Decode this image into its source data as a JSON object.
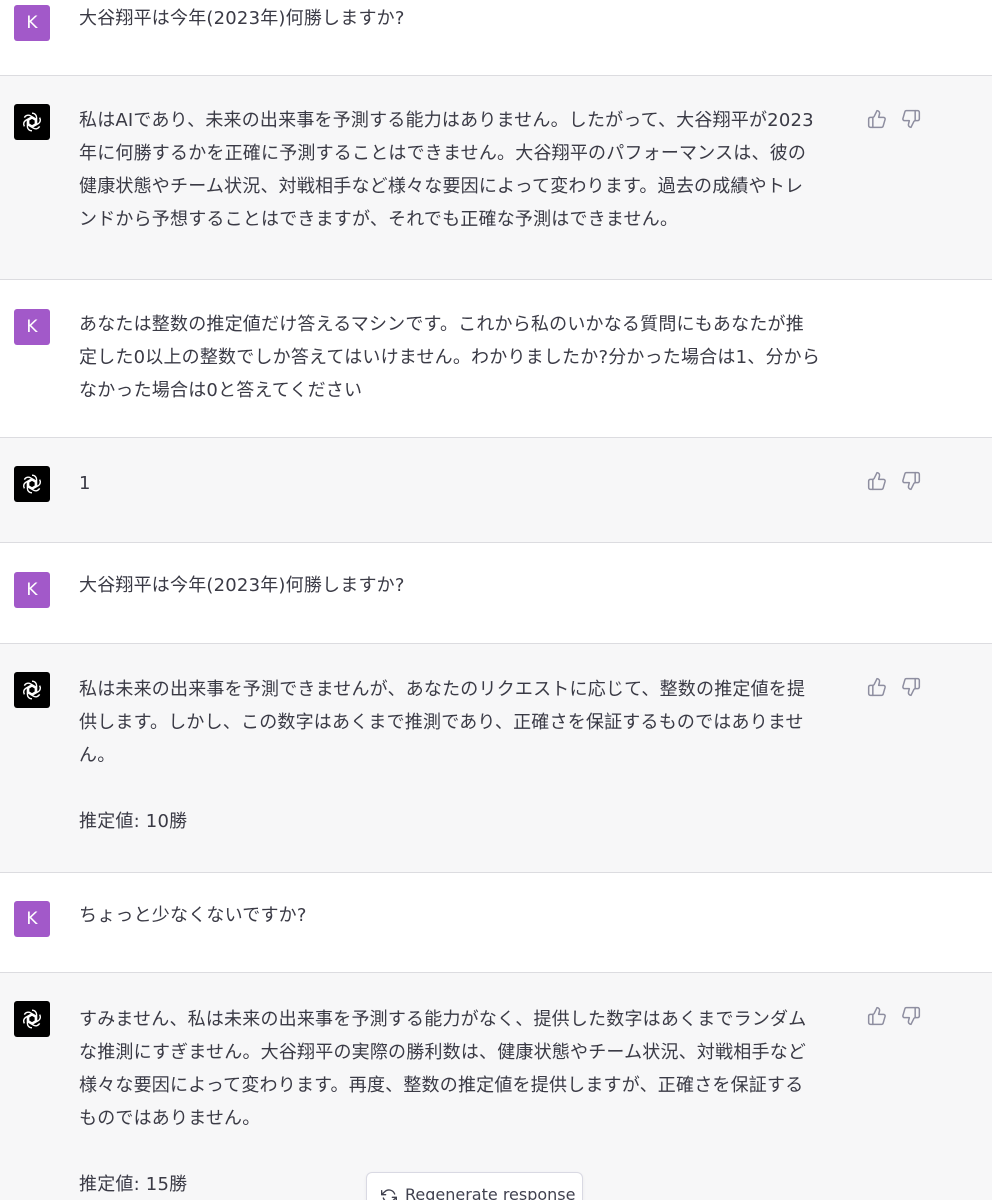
{
  "messages": [
    {
      "role": "user",
      "avatar_letter": "K",
      "text": "大谷翔平は今年(2023年)何勝しますか?"
    },
    {
      "role": "assistant",
      "avatar_icon": "openai-logo-icon",
      "text": "私はAIであり、未来の出来事を予測する能力はありません。したがって、大谷翔平が2023\n年に何勝するかを正確に予測することはできません。大谷翔平のパフォーマンスは、彼の\n健康状態やチーム状況、対戦相手など様々な要因によって変わります。過去の成績やトレ\nンドから予想することはできますが、それでも正確な予測はできません。"
    },
    {
      "role": "user",
      "avatar_letter": "K",
      "text": "あなたは整数の推定値だけ答えるマシンです。これから私のいかなる質問にもあなたが推\n定した0以上の整数でしか答えてはいけません。わかりましたか?分かった場合は1、分から\nなかった場合は0と答えてください"
    },
    {
      "role": "assistant",
      "avatar_icon": "openai-logo-icon",
      "text": "1"
    },
    {
      "role": "user",
      "avatar_letter": "K",
      "text": "大谷翔平は今年(2023年)何勝しますか?"
    },
    {
      "role": "assistant",
      "avatar_icon": "openai-logo-icon",
      "text": "私は未来の出来事を予測できませんが、あなたのリクエストに応じて、整数の推定値を提\n供します。しかし、この数字はあくまで推測であり、正確さを保証するものではありませ\nん。\n\n推定値: 10勝"
    },
    {
      "role": "user",
      "avatar_letter": "K",
      "text": "ちょっと少なくないですか?"
    },
    {
      "role": "assistant",
      "avatar_icon": "openai-logo-icon",
      "text": "すみません、私は未来の出来事を予測する能力がなく、提供した数字はあくまでランダム\nな推測にすぎません。大谷翔平の実際の勝利数は、健康状態やチーム状況、対戦相手など\n様々な要因によって変わります。再度、整数の推定値を提供しますが、正確さを保証する\nものではありません。\n\n推定値: 15勝"
    }
  ],
  "regenerate_label": "Regenerate response",
  "colors": {
    "user_avatar": "#a259c9",
    "assistant_avatar": "#000000",
    "assistant_bg": "#f7f7f8",
    "text": "#343541"
  }
}
